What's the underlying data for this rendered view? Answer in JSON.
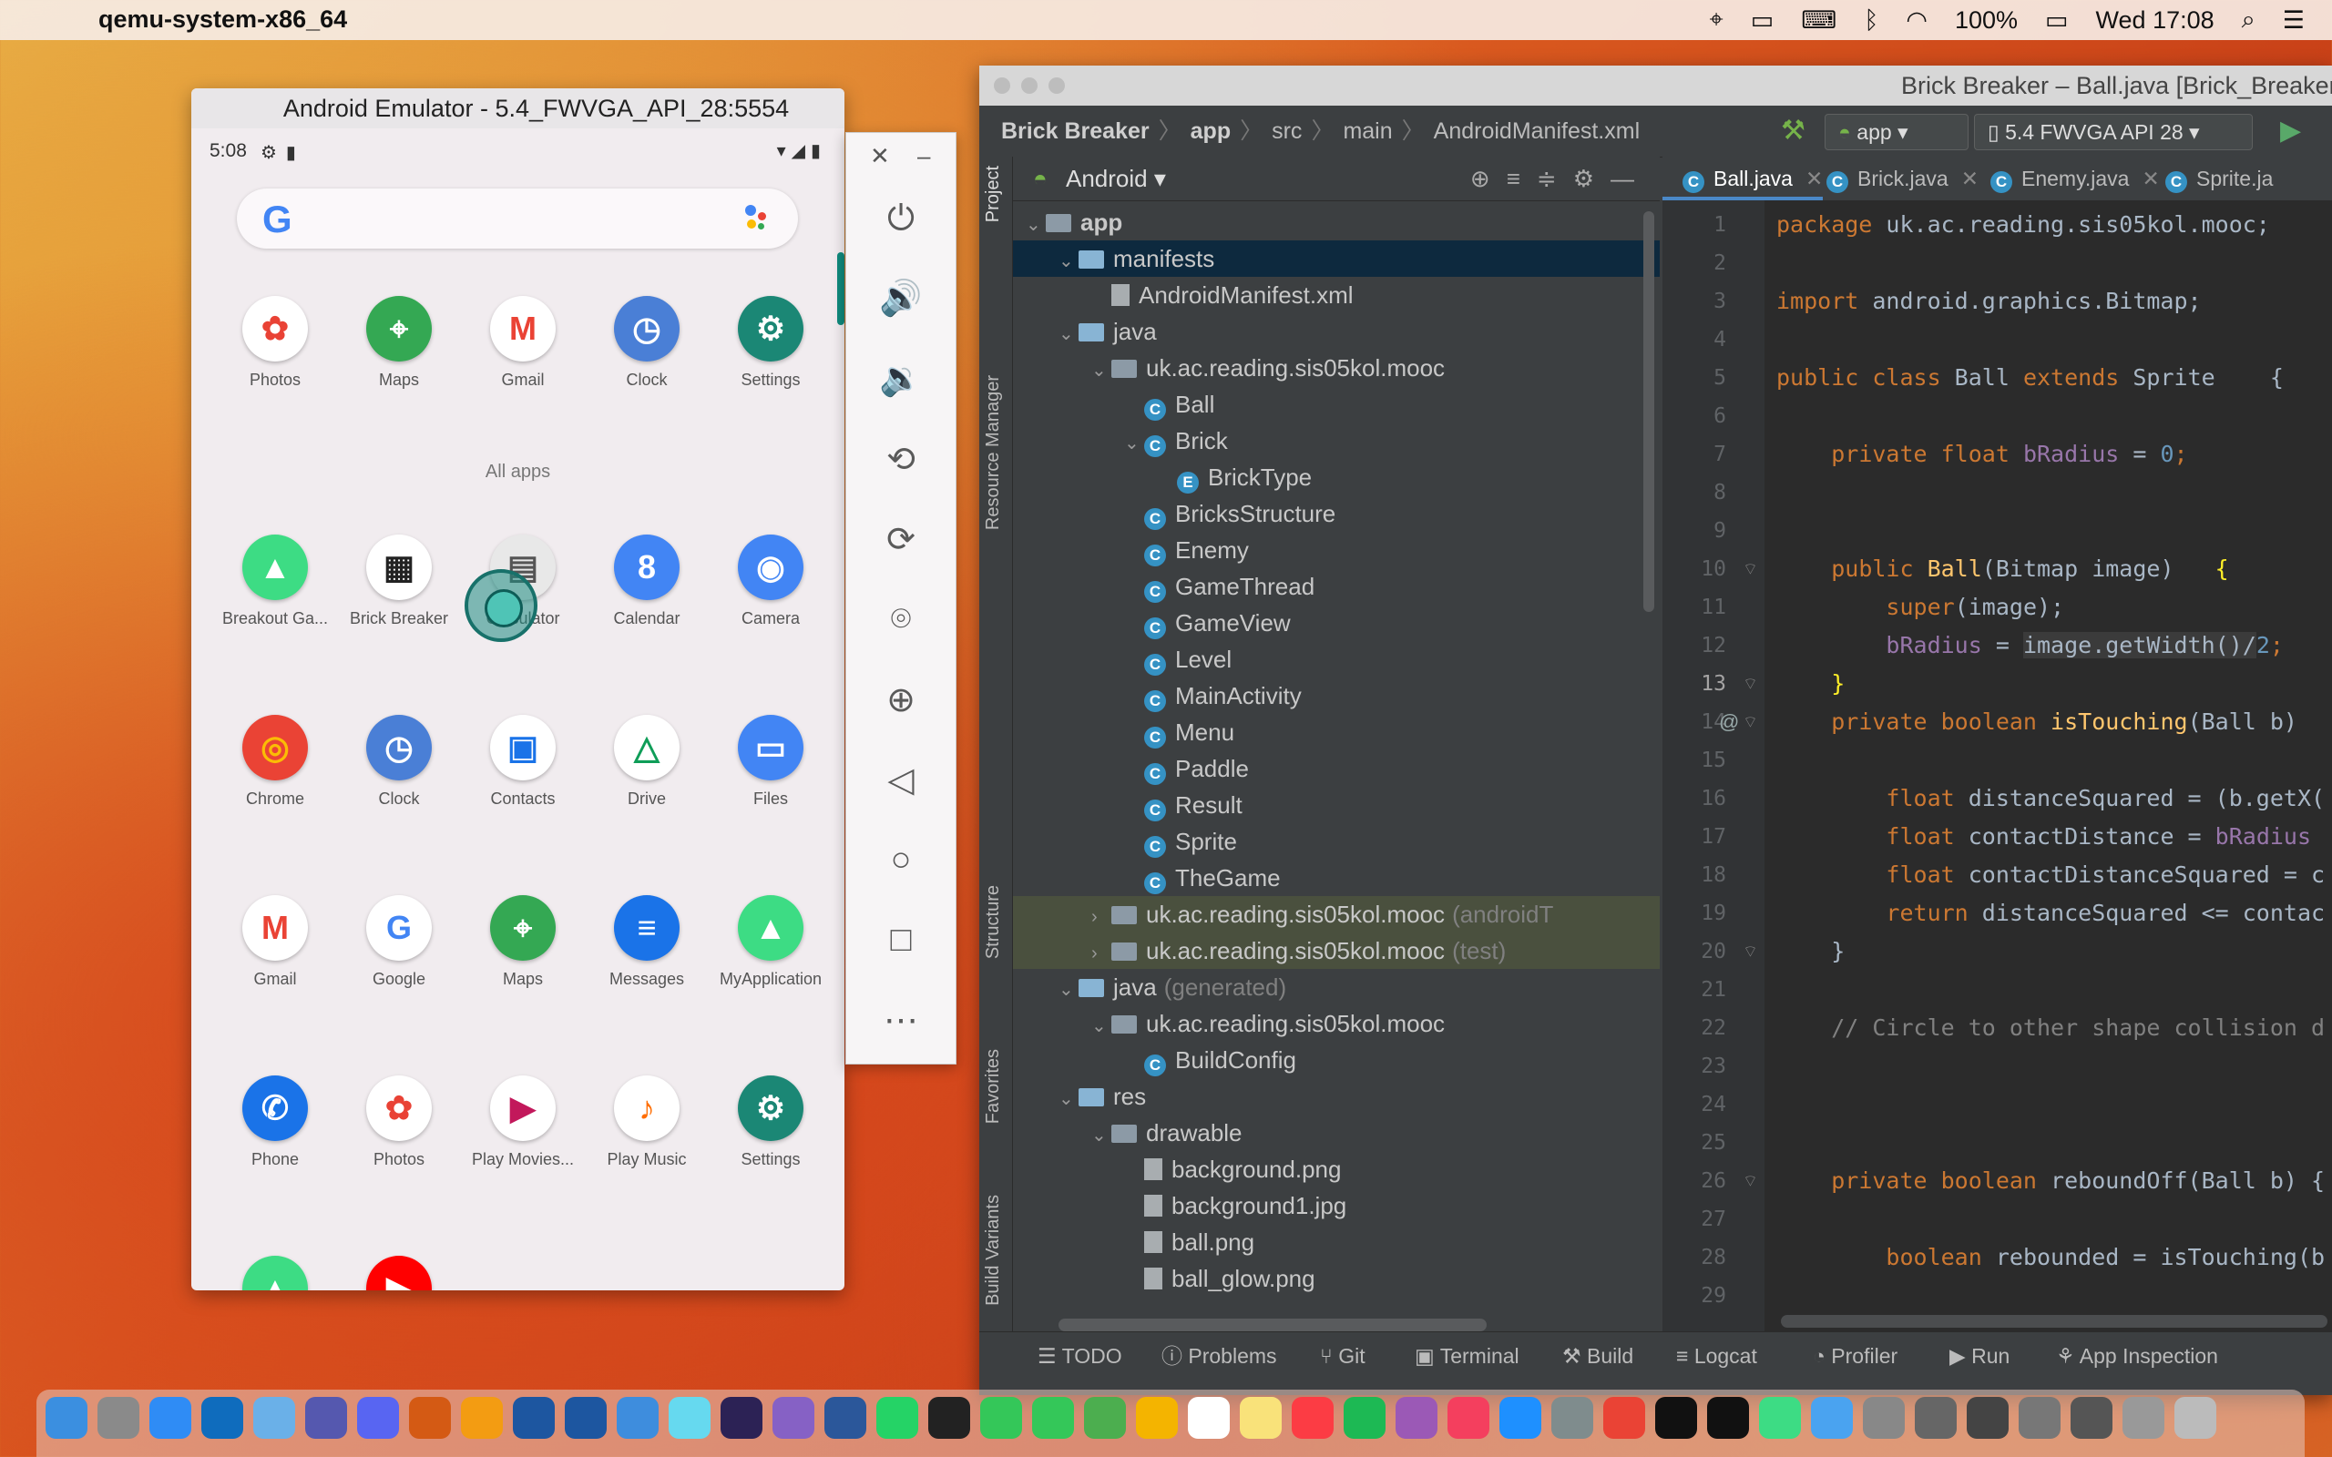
{
  "menubar": {
    "app_name": "qemu-system-x86_64",
    "battery": "100%",
    "datetime": "Wed 17:08",
    "icons": [
      "location-icon",
      "airplay-icon",
      "keyboard-icon",
      "bluetooth-icon",
      "wifi-icon",
      "battery-icon",
      "search-icon",
      "control-center-icon"
    ]
  },
  "emulator": {
    "title": "Android Emulator - 5.4_FWVGA_API_28:5554",
    "status_time": "5:08",
    "favorites": [
      {
        "label": "Photos",
        "color": "#ffffff",
        "glyph": "✿",
        "fg": "#e94235"
      },
      {
        "label": "Maps",
        "color": "#34a853",
        "glyph": "⌖",
        "fg": "#fff"
      },
      {
        "label": "Gmail",
        "color": "#ffffff",
        "glyph": "M",
        "fg": "#ea4335"
      },
      {
        "label": "Clock",
        "color": "#4a7fd6",
        "glyph": "◷",
        "fg": "#fff"
      },
      {
        "label": "Settings",
        "color": "#1b8775",
        "glyph": "⚙",
        "fg": "#fff"
      }
    ],
    "all_apps_label": "All apps",
    "apps_row1": [
      {
        "label": "Breakout Ga...",
        "color": "#3ddc84",
        "glyph": "▲",
        "fg": "#fff"
      },
      {
        "label": "Brick Breaker",
        "color": "#ffffff",
        "glyph": "▦",
        "fg": "#222"
      },
      {
        "label": "Calculator",
        "color": "#e8e8e8",
        "glyph": "▤",
        "fg": "#555"
      },
      {
        "label": "Calendar",
        "color": "#4285f4",
        "glyph": "8",
        "fg": "#fff"
      },
      {
        "label": "Camera",
        "color": "#4285f4",
        "glyph": "◉",
        "fg": "#fff"
      }
    ],
    "apps_row2": [
      {
        "label": "Chrome",
        "color": "#ea4335",
        "glyph": "◎",
        "fg": "#fbbc05"
      },
      {
        "label": "Clock",
        "color": "#4a7fd6",
        "glyph": "◷",
        "fg": "#fff"
      },
      {
        "label": "Contacts",
        "color": "#ffffff",
        "glyph": "▣",
        "fg": "#1a73e8"
      },
      {
        "label": "Drive",
        "color": "#ffffff",
        "glyph": "△",
        "fg": "#0f9d58"
      },
      {
        "label": "Files",
        "color": "#4285f4",
        "glyph": "▭",
        "fg": "#fff"
      }
    ],
    "apps_row3": [
      {
        "label": "Gmail",
        "color": "#ffffff",
        "glyph": "M",
        "fg": "#ea4335"
      },
      {
        "label": "Google",
        "color": "#ffffff",
        "glyph": "G",
        "fg": "#4285f4"
      },
      {
        "label": "Maps",
        "color": "#34a853",
        "glyph": "⌖",
        "fg": "#fff"
      },
      {
        "label": "Messages",
        "color": "#1a73e8",
        "glyph": "≡",
        "fg": "#fff"
      },
      {
        "label": "MyApplication",
        "color": "#3ddc84",
        "glyph": "▲",
        "fg": "#fff"
      }
    ],
    "apps_row4": [
      {
        "label": "Phone",
        "color": "#1a73e8",
        "glyph": "✆",
        "fg": "#fff"
      },
      {
        "label": "Photos",
        "color": "#ffffff",
        "glyph": "✿",
        "fg": "#e94235"
      },
      {
        "label": "Play Movies...",
        "color": "#ffffff",
        "glyph": "▶",
        "fg": "#c2185b"
      },
      {
        "label": "Play Music",
        "color": "#ffffff",
        "glyph": "♪",
        "fg": "#ff6d00"
      },
      {
        "label": "Settings",
        "color": "#1b8775",
        "glyph": "⚙",
        "fg": "#fff"
      }
    ]
  },
  "emulator_tools": [
    "power-icon",
    "volume-up-icon",
    "volume-down-icon",
    "rotate-left-icon",
    "rotate-right-icon",
    "camera-icon",
    "zoom-icon",
    "back-icon",
    "home-icon",
    "overview-icon",
    "more-icon"
  ],
  "studio": {
    "title": "Brick Breaker – Ball.java [Brick_Breaker",
    "breadcrumbs": [
      "Brick Breaker",
      "app",
      "src",
      "main",
      "AndroidManifest.xml"
    ],
    "run_config": "app",
    "device": "5.4  FWVGA API 28",
    "side_tabs": [
      "Project",
      "Resource Manager",
      "Structure",
      "Favorites",
      "Build Variants"
    ],
    "project_view": "Android",
    "tree": [
      {
        "depth": 0,
        "arrow": "⌄",
        "kind": "foldg",
        "label": "app",
        "bold": true
      },
      {
        "depth": 1,
        "arrow": "⌄",
        "kind": "fold",
        "label": "manifests",
        "sel": true
      },
      {
        "depth": 2,
        "arrow": "",
        "kind": "file",
        "label": "AndroidManifest.xml"
      },
      {
        "depth": 1,
        "arrow": "⌄",
        "kind": "fold",
        "label": "java"
      },
      {
        "depth": 2,
        "arrow": "⌄",
        "kind": "foldg",
        "label": "uk.ac.reading.sis05kol.mooc"
      },
      {
        "depth": 3,
        "arrow": "",
        "kind": "cls",
        "label": "Ball"
      },
      {
        "depth": 3,
        "arrow": "⌄",
        "kind": "cls",
        "label": "Brick"
      },
      {
        "depth": 4,
        "arrow": "",
        "kind": "enum",
        "label": "BrickType"
      },
      {
        "depth": 3,
        "arrow": "",
        "kind": "cls",
        "label": "BricksStructure"
      },
      {
        "depth": 3,
        "arrow": "",
        "kind": "cls",
        "label": "Enemy"
      },
      {
        "depth": 3,
        "arrow": "",
        "kind": "cls",
        "label": "GameThread"
      },
      {
        "depth": 3,
        "arrow": "",
        "kind": "cls",
        "label": "GameView"
      },
      {
        "depth": 3,
        "arrow": "",
        "kind": "cls",
        "label": "Level"
      },
      {
        "depth": 3,
        "arrow": "",
        "kind": "cls",
        "label": "MainActivity"
      },
      {
        "depth": 3,
        "arrow": "",
        "kind": "cls",
        "label": "Menu"
      },
      {
        "depth": 3,
        "arrow": "",
        "kind": "cls",
        "label": "Paddle"
      },
      {
        "depth": 3,
        "arrow": "",
        "kind": "cls",
        "label": "Result"
      },
      {
        "depth": 3,
        "arrow": "",
        "kind": "cls",
        "label": "Sprite"
      },
      {
        "depth": 3,
        "arrow": "",
        "kind": "cls",
        "label": "TheGame"
      },
      {
        "depth": 2,
        "arrow": "›",
        "kind": "foldg",
        "label": "uk.ac.reading.sis05kol.mooc",
        "suffix": "(androidT",
        "hl": true
      },
      {
        "depth": 2,
        "arrow": "›",
        "kind": "foldg",
        "label": "uk.ac.reading.sis05kol.mooc",
        "suffix": "(test)",
        "hl": true
      },
      {
        "depth": 1,
        "arrow": "⌄",
        "kind": "fold",
        "label": "java",
        "suffix": "(generated)"
      },
      {
        "depth": 2,
        "arrow": "⌄",
        "kind": "foldg",
        "label": "uk.ac.reading.sis05kol.mooc"
      },
      {
        "depth": 3,
        "arrow": "",
        "kind": "cls",
        "label": "BuildConfig"
      },
      {
        "depth": 1,
        "arrow": "⌄",
        "kind": "fold",
        "label": "res"
      },
      {
        "depth": 2,
        "arrow": "⌄",
        "kind": "foldg",
        "label": "drawable"
      },
      {
        "depth": 3,
        "arrow": "",
        "kind": "file",
        "label": "background.png"
      },
      {
        "depth": 3,
        "arrow": "",
        "kind": "file",
        "label": "background1.jpg"
      },
      {
        "depth": 3,
        "arrow": "",
        "kind": "file",
        "label": "ball.png"
      },
      {
        "depth": 3,
        "arrow": "",
        "kind": "file",
        "label": "ball_glow.png"
      }
    ],
    "editor_tabs": [
      "Ball.java",
      "Brick.java",
      "Enemy.java",
      "Sprite.ja"
    ],
    "code_lines": [
      [
        [
          "kw",
          "package "
        ],
        [
          "",
          "uk.ac.reading.sis05kol.mooc;"
        ]
      ],
      [],
      [
        [
          "kw",
          "import "
        ],
        [
          "",
          "android.graphics.Bitmap;"
        ]
      ],
      [],
      [
        [
          "kw",
          "public class "
        ],
        [
          "",
          "Ball "
        ],
        [
          "kw",
          "extends "
        ],
        [
          "",
          "Sprite    {"
        ]
      ],
      [],
      [
        [
          "",
          "    "
        ],
        [
          "kw",
          "private float "
        ],
        [
          "fld",
          "bRadius"
        ],
        [
          "",
          " = "
        ],
        [
          "num",
          "0"
        ],
        [
          "kw",
          ";"
        ]
      ],
      [],
      [],
      [
        [
          "",
          "    "
        ],
        [
          "kw",
          "public "
        ],
        [
          "fn",
          "Ball"
        ],
        [
          "",
          "(Bitmap image)   "
        ],
        [
          "brace",
          "{"
        ]
      ],
      [
        [
          "",
          "        "
        ],
        [
          "kw",
          "super"
        ],
        [
          "",
          "(image);"
        ]
      ],
      [
        [
          "",
          "        "
        ],
        [
          "fld",
          "bRadius"
        ],
        [
          "",
          " = "
        ],
        [
          "mark",
          "image.getWidth()/"
        ],
        [
          "num",
          "2"
        ],
        [
          "kw",
          ";"
        ]
      ],
      [
        [
          "",
          "    "
        ],
        [
          "brace",
          "}"
        ]
      ],
      [
        [
          "",
          "    "
        ],
        [
          "kw",
          "private boolean "
        ],
        [
          "fn",
          "isTouching"
        ],
        [
          "",
          "(Ball b)"
        ]
      ],
      [],
      [
        [
          "",
          "        "
        ],
        [
          "kw",
          "float "
        ],
        [
          "",
          "distanceSquared = (b.getX("
        ]
      ],
      [
        [
          "",
          "        "
        ],
        [
          "kw",
          "float "
        ],
        [
          "",
          "contactDistance = "
        ],
        [
          "fld",
          "bRadius"
        ]
      ],
      [
        [
          "",
          "        "
        ],
        [
          "kw",
          "float "
        ],
        [
          "",
          "contactDistanceSquared = c"
        ]
      ],
      [
        [
          "",
          "        "
        ],
        [
          "kw",
          "return "
        ],
        [
          "",
          "distanceSquared <= contac"
        ]
      ],
      [
        [
          "",
          "    }"
        ]
      ],
      [],
      [
        [
          "",
          "    "
        ],
        [
          "cmt",
          "// Circle to other shape collision d"
        ]
      ],
      [],
      [],
      [],
      [
        [
          "",
          "    "
        ],
        [
          "kw",
          "private boolean "
        ],
        [
          "",
          "reboundOff(Ball b) {"
        ]
      ],
      [],
      [
        [
          "",
          "        "
        ],
        [
          "kw",
          "boolean "
        ],
        [
          "",
          "rebounded = isTouching(b"
        ]
      ],
      []
    ],
    "bottom_tools": [
      "TODO",
      "Problems",
      "Git",
      "Terminal",
      "Build",
      "Logcat",
      "Profiler",
      "Run",
      "App Inspection"
    ]
  },
  "dock": {
    "icons": [
      "finder-icon",
      "launchpad-icon",
      "safari-icon",
      "outlook-icon",
      "preview-icon",
      "teams-icon",
      "discord-icon",
      "matlab-icon",
      "vlc-icon",
      "virtualbox-icon",
      "virtualbox-2-icon",
      "xcode-icon",
      "atom-icon",
      "eclipse-icon",
      "visual-studio-icon",
      "word-icon",
      "whatsapp-icon",
      "headphones-icon",
      "facetime-icon",
      "messages-icon",
      "maps-icon",
      "photos-icon",
      "calendar-icon",
      "notes-icon",
      "music-icon",
      "spotify-icon",
      "podcasts-icon",
      "news-icon",
      "app-store-icon",
      "system-preferences-icon",
      "chrome-icon",
      "terminal-icon",
      "intellij-icon",
      "android-studio-icon",
      "folder-icon",
      "window-1-icon",
      "window-2-icon",
      "window-3-icon",
      "window-4-icon",
      "window-5-icon",
      "window-6-icon",
      "trash-icon"
    ],
    "colors": [
      "#3b8fe0",
      "#8a8a8a",
      "#2f8cf5",
      "#0f6cbd",
      "#6ab0e8",
      "#5558af",
      "#5865f2",
      "#d45a14",
      "#f39c12",
      "#1d56a0",
      "#1d56a0",
      "#3e8ddd",
      "#66d9ef",
      "#2c2255",
      "#8661c5",
      "#2b579a",
      "#25d366",
      "#222222",
      "#34c759",
      "#34c759",
      "#4cae4f",
      "#f4b400",
      "#ffffff",
      "#f9e27a",
      "#fc3c44",
      "#1db954",
      "#9b59b6",
      "#f43f5e",
      "#1e90ff",
      "#7f8c8d",
      "#ea4335",
      "#111111",
      "#111111",
      "#3ddc84",
      "#4aa3f0",
      "#888888",
      "#666666",
      "#444444",
      "#777777",
      "#555555",
      "#999999",
      "#bbbbbb"
    ]
  }
}
